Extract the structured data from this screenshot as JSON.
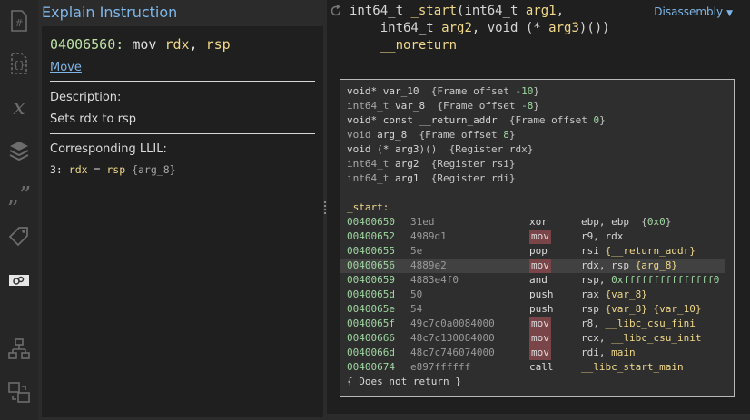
{
  "sidebar": {
    "icons": [
      "hash-icon",
      "braces-icon",
      "variable-x-icon",
      "layers-icon",
      "quote-icon",
      "tag-icon",
      "explain-icon",
      "graph-tree-icon",
      "compare-icon"
    ]
  },
  "explain": {
    "title": "Explain Instruction",
    "address": "04006560:",
    "mnemonic": "mov",
    "operand1": "rdx",
    "operand_sep": ", ",
    "operand2": "rsp",
    "link": "Move",
    "description_label": "Description:",
    "description": "Sets rdx to rsp",
    "llil_label": "Corresponding LLIL:",
    "llil_index": "3:",
    "llil_dest": "rdx",
    "llil_eq": " = ",
    "llil_src": "rsp",
    "llil_var": "{arg_8}"
  },
  "header": {
    "sig_l1a": "int64_t ",
    "sig_fn": "_start",
    "sig_l1b": "(int64_t ",
    "sig_arg1": "arg1",
    "sig_l1c": ",",
    "sig_l2a": "    int64_t ",
    "sig_arg2": "arg2",
    "sig_l2b": ", void (* ",
    "sig_arg3": "arg3",
    "sig_l2c": ")())",
    "sig_l3": "    __noreturn",
    "view": "Disassembly"
  },
  "stack_vars": [
    {
      "type": "void*",
      "name": "var_10",
      "info": "{Frame offset ",
      "num": "-10",
      "close": "}"
    },
    {
      "type": "int64_t",
      "name": "var_8",
      "info": "{Frame offset ",
      "num": "-8",
      "close": "}"
    },
    {
      "type": "void* const",
      "name": "__return_addr",
      "info": "{Frame offset ",
      "num": "0",
      "close": "}"
    },
    {
      "type": "void",
      "name": "arg_8",
      "info": "{Frame offset ",
      "num": "8",
      "close": "}"
    },
    {
      "type": "void (*",
      "name": "arg3",
      "info": ")()  {Register rdx}",
      "num": "",
      "close": ""
    },
    {
      "type": "int64_t",
      "name": "arg2",
      "info": "{Register rsi}",
      "num": "",
      "close": ""
    },
    {
      "type": "int64_t",
      "name": "arg1",
      "info": "{Register rdi}",
      "num": "",
      "close": ""
    }
  ],
  "func_label": "_start:",
  "disasm": [
    {
      "addr": "00400650",
      "bytes": "31ed",
      "mn": "xor",
      "ops": "ebp, ebp  {0x0}"
    },
    {
      "addr": "00400652",
      "bytes": "4989d1",
      "mn": "mov",
      "ops": "r9, rdx"
    },
    {
      "addr": "00400655",
      "bytes": "5e",
      "mn": "pop",
      "ops": "rsi {__return_addr}"
    },
    {
      "addr": "00400656",
      "bytes": "4889e2",
      "mn": "mov",
      "ops": "rdx, rsp {arg_8}"
    },
    {
      "addr": "00400659",
      "bytes": "4883e4f0",
      "mn": "and",
      "ops": "rsp, 0xfffffffffffffff0"
    },
    {
      "addr": "0040065d",
      "bytes": "50",
      "mn": "push",
      "ops": "rax {var_8}"
    },
    {
      "addr": "0040065e",
      "bytes": "54",
      "mn": "push",
      "ops": "rsp {var_8} {var_10}"
    },
    {
      "addr": "0040065f",
      "bytes": "49c7c0a0084000",
      "mn": "mov",
      "ops": "r8, __libc_csu_fini"
    },
    {
      "addr": "00400666",
      "bytes": "48c7c130084000",
      "mn": "mov",
      "ops": "rcx, __libc_csu_init"
    },
    {
      "addr": "0040066d",
      "bytes": "48c7c746074000",
      "mn": "mov",
      "ops": "rdi, main"
    },
    {
      "addr": "00400674",
      "bytes": "e897ffffff",
      "mn": "call",
      "ops": "__libc_start_main"
    }
  ],
  "footer": "{ Does not return }",
  "colors": {
    "accent": "#7fb6e8",
    "highlight": "#f0d88a",
    "address": "#9fd7a1",
    "mov_bg": "#7a4548"
  }
}
